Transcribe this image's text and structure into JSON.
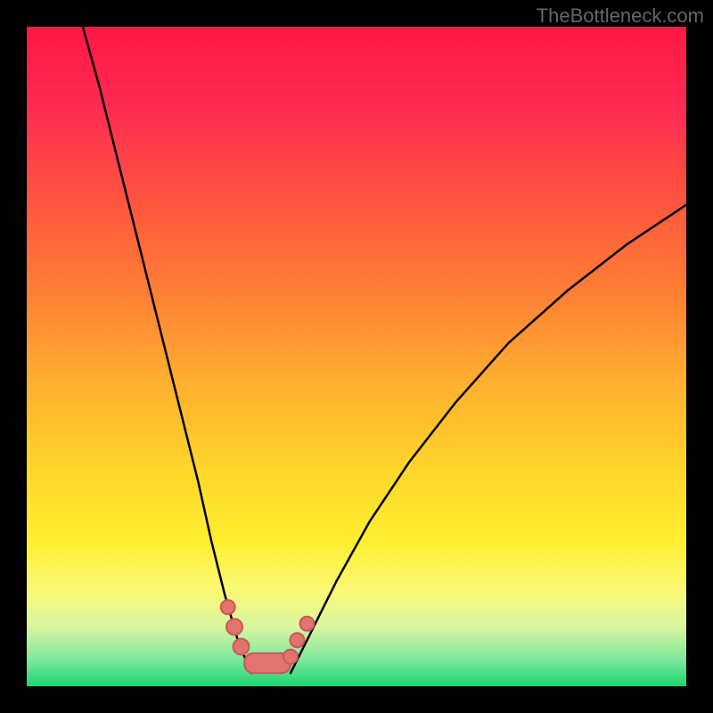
{
  "attribution": "TheBottleneck.com",
  "chart_data": {
    "type": "line",
    "title": "",
    "xlabel": "",
    "ylabel": "",
    "ylim": [
      0,
      100
    ],
    "xlim": [
      0,
      100
    ],
    "background": {
      "gradient_stops": [
        {
          "pos": 0.0,
          "color": "#ff1744"
        },
        {
          "pos": 0.12,
          "color": "#ff2a52"
        },
        {
          "pos": 0.28,
          "color": "#ff5a3d"
        },
        {
          "pos": 0.42,
          "color": "#ff8534"
        },
        {
          "pos": 0.55,
          "color": "#ffb32f"
        },
        {
          "pos": 0.68,
          "color": "#ffd82a"
        },
        {
          "pos": 0.78,
          "color": "#ffee2f"
        },
        {
          "pos": 0.86,
          "color": "#f8f97a"
        },
        {
          "pos": 0.91,
          "color": "#d8f5a0"
        },
        {
          "pos": 0.96,
          "color": "#7de89e"
        },
        {
          "pos": 1.0,
          "color": "#1ad670"
        }
      ]
    },
    "series": [
      {
        "name": "left-curve",
        "values": [
          {
            "x": 8.5,
            "y": 100
          },
          {
            "x": 11,
            "y": 91
          },
          {
            "x": 14,
            "y": 79
          },
          {
            "x": 17,
            "y": 67
          },
          {
            "x": 20,
            "y": 55
          },
          {
            "x": 23,
            "y": 43
          },
          {
            "x": 26,
            "y": 31
          },
          {
            "x": 28,
            "y": 22
          },
          {
            "x": 30,
            "y": 14
          },
          {
            "x": 32,
            "y": 7
          },
          {
            "x": 34,
            "y": 2
          }
        ]
      },
      {
        "name": "right-curve",
        "values": [
          {
            "x": 40,
            "y": 2
          },
          {
            "x": 43,
            "y": 8
          },
          {
            "x": 47,
            "y": 16
          },
          {
            "x": 52,
            "y": 25
          },
          {
            "x": 58,
            "y": 34
          },
          {
            "x": 65,
            "y": 43
          },
          {
            "x": 73,
            "y": 52
          },
          {
            "x": 82,
            "y": 60
          },
          {
            "x": 91,
            "y": 67
          },
          {
            "x": 100,
            "y": 73
          }
        ]
      }
    ],
    "markers": {
      "color": "#e2736f",
      "stroke": "#c95a56",
      "left_radii": [
        8,
        9,
        9
      ],
      "right_radii": [
        8,
        8,
        8
      ],
      "left_points": [
        {
          "x": 30.5,
          "y": 12
        },
        {
          "x": 31.5,
          "y": 9
        },
        {
          "x": 32.5,
          "y": 6
        }
      ],
      "right_points": [
        {
          "x": 40.0,
          "y": 4.5
        },
        {
          "x": 41.0,
          "y": 7
        },
        {
          "x": 42.5,
          "y": 9.5
        }
      ],
      "bottom_bar": {
        "x": 33,
        "w": 7,
        "y": 2,
        "h": 3,
        "r": 10
      }
    }
  }
}
